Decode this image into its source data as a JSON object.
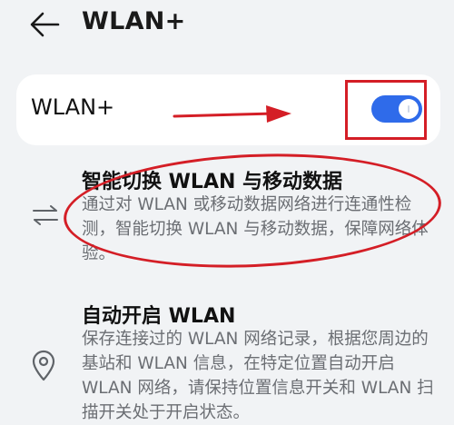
{
  "header": {
    "back_icon": "arrow-left-icon",
    "title": "WLAN+"
  },
  "wlan_plus": {
    "label": "WLAN+",
    "toggle_on": true,
    "accent_color": "#2f6bea"
  },
  "features": [
    {
      "icon": "swap-arrows-icon",
      "title": "智能切换 WLAN 与移动数据",
      "description": "通过对 WLAN 或移动数据网络进行连通性检测，智能切换 WLAN 与移动数据，保障网络体验。"
    },
    {
      "icon": "location-pin-icon",
      "title": "自动开启 WLAN",
      "description": "保存连接过的 WLAN 网络记录，根据您周边的基站和 WLAN 信息，在特定位置自动开启 WLAN 网络，请保持位置信息开关和 WLAN 扫描开关处于开启状态。"
    }
  ],
  "annotations": {
    "highlight_color": "#d41e26"
  }
}
